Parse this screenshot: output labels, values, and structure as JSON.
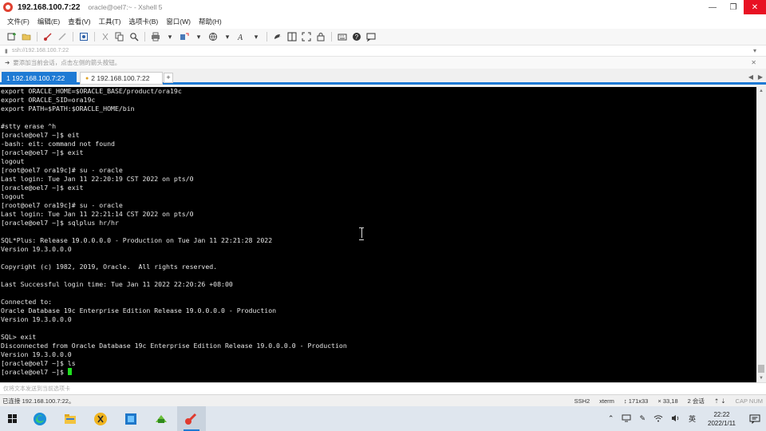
{
  "window": {
    "title": "192.168.100.7:22",
    "subtitle": "oracle@oel7:~ - Xshell 5",
    "controls": [
      "—",
      "❐",
      "✕"
    ]
  },
  "menu": [
    "文件(F)",
    "编辑(E)",
    "查看(V)",
    "工具(T)",
    "选项卡(B)",
    "窗口(W)",
    "帮助(H)"
  ],
  "address": "ssh://192.168.100.7:22",
  "quickbar_hint": "要添加当前会话，点击左侧的箭头按钮。",
  "tabs": [
    {
      "label": "1 192.168.100.7:22",
      "active": true
    },
    {
      "label": "2 192.168.100.7:22",
      "active": false
    }
  ],
  "tab_add": "+",
  "terminal": {
    "lines": [
      "export ORACLE_HOME=$ORACLE_BASE/product/ora19c",
      "export ORACLE_SID=ora19c",
      "export PATH=$PATH:$ORACLE_HOME/bin",
      "",
      "#stty erase ^h",
      "[oracle@oel7 ~]$ eit",
      "-bash: eit: command not found",
      "[oracle@oel7 ~]$ exit",
      "logout",
      "[root@oel7 ora19c]# su - oracle",
      "Last login: Tue Jan 11 22:20:19 CST 2022 on pts/0",
      "[oracle@oel7 ~]$ exit",
      "logout",
      "[root@oel7 ora19c]# su - oracle",
      "Last login: Tue Jan 11 22:21:14 CST 2022 on pts/0",
      "[oracle@oel7 ~]$ sqlplus hr/hr",
      "",
      "SQL*Plus: Release 19.0.0.0.0 - Production on Tue Jan 11 22:21:28 2022",
      "Version 19.3.0.0.0",
      "",
      "Copyright (c) 1982, 2019, Oracle.  All rights reserved.",
      "",
      "Last Successful login time: Tue Jan 11 2022 22:20:26 +08:00",
      "",
      "Connected to:",
      "Oracle Database 19c Enterprise Edition Release 19.0.0.0.0 - Production",
      "Version 19.3.0.0.0",
      "",
      "SQL> exit",
      "Disconnected from Oracle Database 19c Enterprise Edition Release 19.0.0.0.0 - Production",
      "Version 19.3.0.0.0",
      "[oracle@oel7 ~]$ ls",
      "[oracle@oel7 ~]$ "
    ]
  },
  "input_hint": "仅将文本发送到当前选项卡",
  "status": {
    "connection": "已连接 192.168.100.7:22。",
    "protocol": "SSH2",
    "term": "xterm",
    "size": "171x33",
    "cursor": "33,18",
    "sessions": "2 会话",
    "keys": "CAP NUM"
  },
  "taskbar": {
    "apps": [
      "windows-start",
      "edge",
      "file-explorer",
      "xftp",
      "virtualbox",
      "terminal-app",
      "xshell"
    ],
    "tray_lang": "英",
    "time": "22:22",
    "date": "2022/1/11"
  },
  "colors": {
    "accent": "#1e7ad4",
    "terminal_bg": "#000000",
    "terminal_fg": "#e6e6e6",
    "cursor": "#20e020",
    "close_button": "#e81123"
  }
}
